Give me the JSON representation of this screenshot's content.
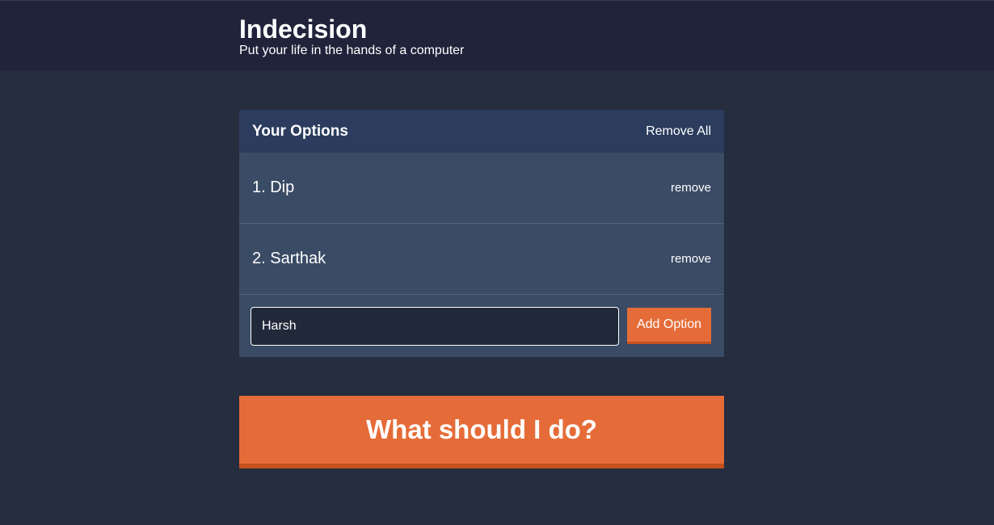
{
  "header": {
    "title": "Indecision",
    "subtitle": "Put your life in the hands of a computer"
  },
  "options_panel": {
    "title": "Your Options",
    "remove_all_label": "Remove All",
    "items": [
      {
        "text": "1. Dip",
        "remove_label": "remove"
      },
      {
        "text": "2. Sarthak",
        "remove_label": "remove"
      }
    ],
    "input_value": "Harsh",
    "add_button_label": "Add Option"
  },
  "action_button_label": "What should I do?",
  "colors": {
    "background": "#252d3e",
    "header_background": "#20233a",
    "panel_header": "#2b3c5e",
    "panel_body": "#3a4b65",
    "accent": "#e56c38"
  }
}
